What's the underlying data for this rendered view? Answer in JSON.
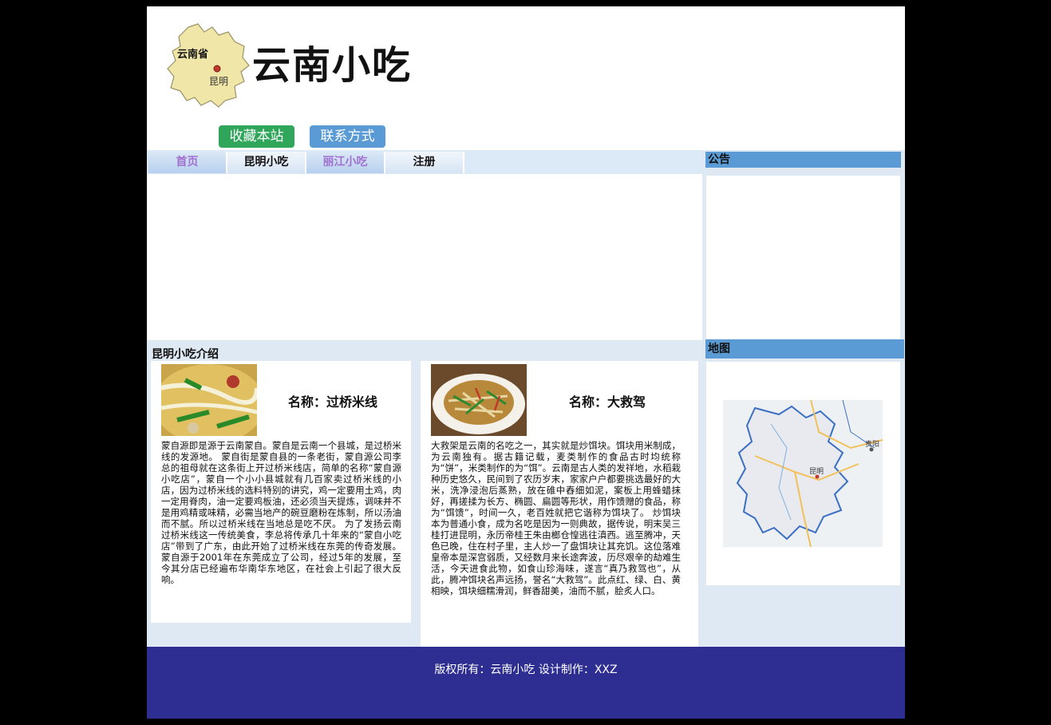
{
  "header": {
    "logo_province": "云南省",
    "logo_city": "昆明",
    "title": "云南小吃",
    "buttons": [
      "收藏本站",
      "联系方式"
    ]
  },
  "nav": {
    "items": [
      "首页",
      "昆明小吃",
      "丽江小吃",
      "注册"
    ]
  },
  "sidebar": {
    "notice_title": "公告",
    "map_title": "地图",
    "map_label_city": "昆明",
    "map_label_city2": "贵阳"
  },
  "intro": {
    "title": "昆明小吃介绍",
    "cards": [
      {
        "name": "名称：过桥米线",
        "desc": "蒙自源即是源于云南蒙自。蒙自是云南一个县城，是过桥米线的发源地。 蒙自街是蒙自县的一条老街，蒙自源公司李总的祖母就在这条街上开过桥米线店，简单的名称“蒙自源小吃店”，蒙自一个小小县城就有几百家卖过桥米线的小店，因为过桥米线的选料特别的讲究，鸡一定要用土鸡，肉一定用脊肉，油一定要鸡板油，还必须当天提炼，调味并不是用鸡精或味精，必需当地产的碗豆磨粉在炼制，所以汤油而不腻。所以过桥米线在当地总是吃不厌。 为了发扬云南过桥米线这一传统美食，李总将传承几十年来的“蒙自小吃店”带到了广东，由此开始了过桥米线在东莞的传奇发展。蒙自源于2001年在东莞成立了公司，经过5年的发展，至今其分店已经遍布华南华东地区，在社会上引起了很大反响。"
      },
      {
        "name": "名称：大救驾",
        "desc": "大救架是云南的名吃之一，其实就是炒饵块。饵块用米制成，为云南独有。据古籍记载，麦类制作的食品古时均统称为“饼”，米类制作的为“饵”。云南是古人类的发祥地，水稻栽种历史悠久，民间到了农历岁末，家家户户都要挑选最好的大米，洗净浸泡后蒸熟，放在碓中舂细如泥，案板上用蜂蜡抹好，再搓揉为长方、椭圆、扁圆等形状，用作馈赠的食品，称为“饵馈”，时间一久，老百姓就把它谐称为饵块了。 炒饵块本为普通小食，成为名吃是因为一则典故，据传说，明末吴三桂打进昆明，永历帝桂王朱由榔仓惶逃往滇西。逃至腾冲，天色已晚，住在村子里，主人炒一了盘饵块让其充饥。这位落难皇帝本是深宫弱质，又经数月来长途奔波，历尽艰辛的劫难生活，今天进食此物，如食山珍海味，遂言“真乃救驾也”，从此，腾冲饵块名声远扬，誉名“大救驾”。此点红、绿、白、黄相映，饵块细糯滑润，鲜香甜美，油而不腻，脍炙人口。"
      }
    ]
  },
  "footer": {
    "text": "版权所有：云南小吃  设计制作：XXZ"
  },
  "colors": {
    "nav_bg": "#b7d0ee",
    "title_bar": "#5b9bd5",
    "footer_bg": "#2e2e92",
    "fav_button": "#2fa65a",
    "contact_button": "#5b9bd5"
  }
}
